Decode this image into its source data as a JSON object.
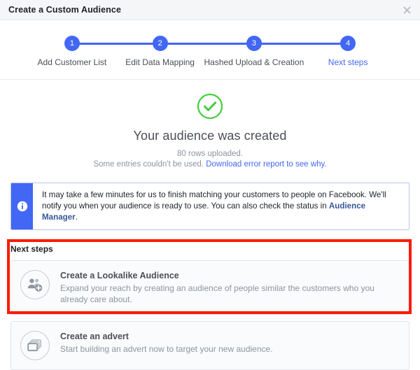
{
  "dialog": {
    "title": "Create a Custom Audience",
    "close_icon": "close-icon"
  },
  "stepper": {
    "steps": [
      {
        "number": "1",
        "label": "Add Customer List",
        "state": "done"
      },
      {
        "number": "2",
        "label": "Edit Data Mapping",
        "state": "done"
      },
      {
        "number": "3",
        "label": "Hashed Upload & Creation",
        "state": "done"
      },
      {
        "number": "4",
        "label": "Next steps",
        "state": "current"
      }
    ],
    "accent_color": "#4267f4"
  },
  "success": {
    "icon": "check-circle-icon",
    "icon_color": "#42cd3c",
    "title": "Your audience was created",
    "rows_line": "80 rows uploaded.",
    "entries_line": "Some entries couldn't be used.",
    "error_report_link": "Download error report to see why."
  },
  "info_banner": {
    "icon": "info-icon",
    "background_color": "#4267f4",
    "text_part_1": "It may take a few minutes for us to finish matching your customers to people on Facebook. We'll notify you when your audience is ready to use. You can also check the status in",
    "link_text": "Audience Manager",
    "text_part_2": "."
  },
  "next_steps": {
    "heading": "Next steps",
    "highlight_color": "#fc1b05",
    "options": [
      {
        "icon": "add-audience-icon",
        "title": "Create a Lookalike Audience",
        "description": "Expand your reach by creating an audience of people similar the customers who you already care about."
      },
      {
        "icon": "advert-windows-icon",
        "title": "Create an advert",
        "description": "Start building an advert now to target your new audience."
      }
    ]
  }
}
